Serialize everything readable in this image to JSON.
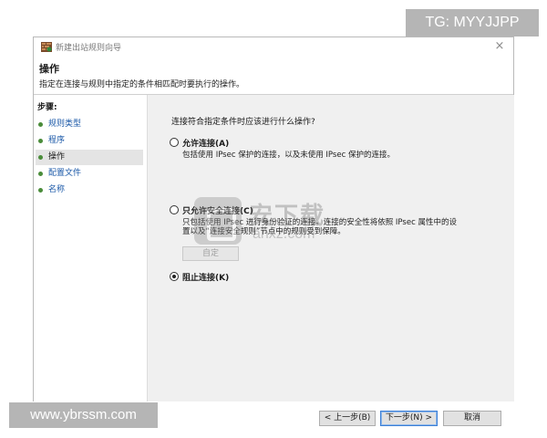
{
  "overlays": {
    "top_right": "TG: MYYJJPP",
    "bottom_left": "www.ybrssm.com",
    "watermark_cn": "安下载",
    "watermark_en": "anxz.com"
  },
  "window": {
    "title": "新建出站规则向导",
    "close_glyph": "×"
  },
  "header": {
    "title": "操作",
    "description": "指定在连接与规则中指定的条件相匹配时要执行的操作。"
  },
  "steps": {
    "label": "步骤:",
    "items": [
      {
        "label": "规则类型",
        "active": false
      },
      {
        "label": "程序",
        "active": false
      },
      {
        "label": "操作",
        "active": true
      },
      {
        "label": "配置文件",
        "active": false
      },
      {
        "label": "名称",
        "active": false
      }
    ]
  },
  "content": {
    "question": "连接符合指定条件时应该进行什么操作?",
    "options": [
      {
        "label": "允许连接(A)",
        "description": [
          "包括使用 IPsec 保护的连接，以及未使用 IPsec 保护的连接。"
        ],
        "checked": false
      },
      {
        "label": "只允许安全连接(C)",
        "description": [
          "只包括使用 IPsec 进行身份验证的连接。连接的安全性将依照 IPsec 属性中的设",
          "置以及“连接安全规则”节点中的规则受到保障。"
        ],
        "checked": false
      },
      {
        "label": "阻止连接(K)",
        "description": [],
        "checked": true
      }
    ],
    "custom_button": "自定"
  },
  "footer": {
    "back": "< 上一步(B)",
    "next": "下一步(N) >",
    "cancel": "取消"
  },
  "colors": {
    "content_bg": "#f0f0f0",
    "link": "#1b59a8",
    "primary_border": "#3c7fd6"
  }
}
